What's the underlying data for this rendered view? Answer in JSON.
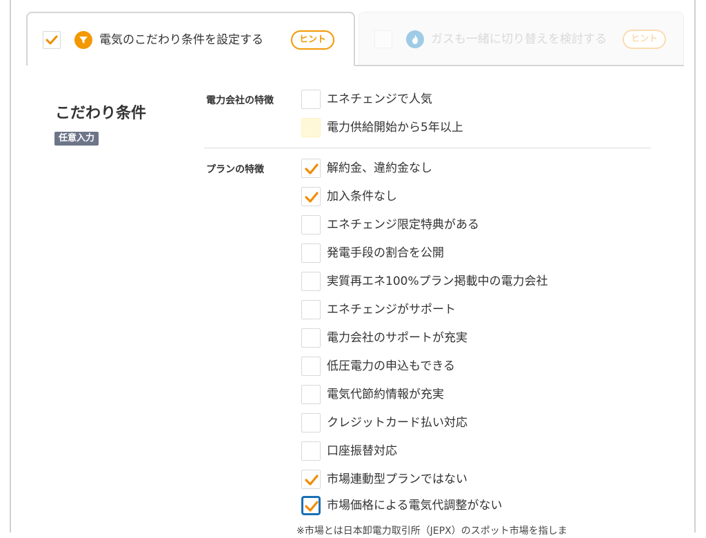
{
  "tabs": [
    {
      "label": "電気のこだわり条件を設定する",
      "hint": "ヒント",
      "checked": true,
      "icon": "filter-icon"
    },
    {
      "label": "ガスも一緒に切り替えを検討する",
      "hint": "ヒント",
      "checked": false,
      "icon": "flame-icon"
    }
  ],
  "section": {
    "title": "こだわり条件",
    "badge": "任意入力"
  },
  "groups": [
    {
      "label": "電力会社の特徴",
      "options": [
        {
          "label": "エネチェンジで人気",
          "checked": false
        },
        {
          "label": "電力供給開始から5年以上",
          "checked": false
        }
      ]
    },
    {
      "label": "プランの特徴",
      "options": [
        {
          "label": "解約金、違約金なし",
          "checked": true
        },
        {
          "label": "加入条件なし",
          "checked": true
        },
        {
          "label": "エネチェンジ限定特典がある",
          "checked": false
        },
        {
          "label": "発電手段の割合を公開",
          "checked": false
        },
        {
          "label": "実質再エネ100%プラン掲載中の電力会社",
          "checked": false
        },
        {
          "label": "エネチェンジがサポート",
          "checked": false
        },
        {
          "label": "電力会社のサポートが充実",
          "checked": false
        },
        {
          "label": "低圧電力の申込もできる",
          "checked": false
        },
        {
          "label": "電気代節約情報が充実",
          "checked": false
        },
        {
          "label": "クレジットカード払い対応",
          "checked": false
        },
        {
          "label": "口座振替対応",
          "checked": false
        },
        {
          "label": "市場連動型プランではない",
          "checked": true
        },
        {
          "label": "市場価格による電気代調整がない",
          "checked": true
        }
      ]
    }
  ],
  "footnote": "※市場とは日本卸電力取引所（JEPX）のスポット市場を指しま",
  "colors": {
    "accent": "#f39800",
    "check": "#f08c00",
    "focus": "#1a6fb5",
    "badge": "#6d7589",
    "gas": "#9fcbe6"
  }
}
